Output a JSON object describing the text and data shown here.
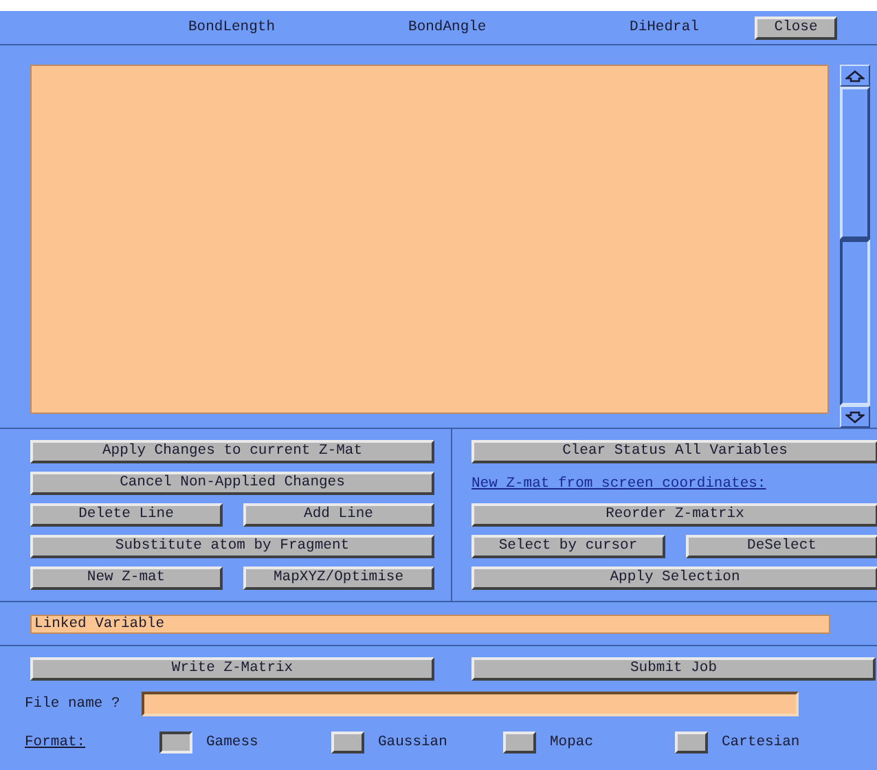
{
  "header": {
    "columns": [
      "BondLength",
      "BondAngle",
      "DiHedral"
    ],
    "close": "Close"
  },
  "left_panel": [
    [
      {
        "kind": "button",
        "label": "Apply Changes to current Z-Mat"
      }
    ],
    [
      {
        "kind": "button",
        "label": "Cancel Non-Applied Changes"
      }
    ],
    [
      {
        "kind": "button",
        "label": "Delete Line"
      },
      {
        "kind": "button",
        "label": "Add Line"
      }
    ],
    [
      {
        "kind": "button",
        "label": "Substitute atom by Fragment"
      }
    ],
    [
      {
        "kind": "button",
        "label": "New Z-mat"
      },
      {
        "kind": "button",
        "label": "MapXYZ/Optimise"
      }
    ]
  ],
  "right_panel": [
    [
      {
        "kind": "button",
        "label": "Clear Status All Variables"
      }
    ],
    [
      {
        "kind": "link",
        "label": "New Z-mat from screen coordinates:"
      }
    ],
    [
      {
        "kind": "button",
        "label": "Reorder Z-matrix"
      }
    ],
    [
      {
        "kind": "button",
        "label": "Select by cursor"
      },
      {
        "kind": "button",
        "label": "DeSelect"
      }
    ],
    [
      {
        "kind": "button",
        "label": "Apply Selection"
      }
    ]
  ],
  "linked_variable": {
    "value": "Linked Variable"
  },
  "bottom": {
    "buttons": [
      "Write Z-Matrix",
      "Submit Job"
    ],
    "file_label": "File name ?",
    "format_label": "Format:",
    "formats": [
      {
        "label": "Gamess",
        "selected": true
      },
      {
        "label": "Gaussian",
        "selected": false
      },
      {
        "label": "Mopac",
        "selected": false
      },
      {
        "label": "Cartesian",
        "selected": false
      }
    ]
  }
}
